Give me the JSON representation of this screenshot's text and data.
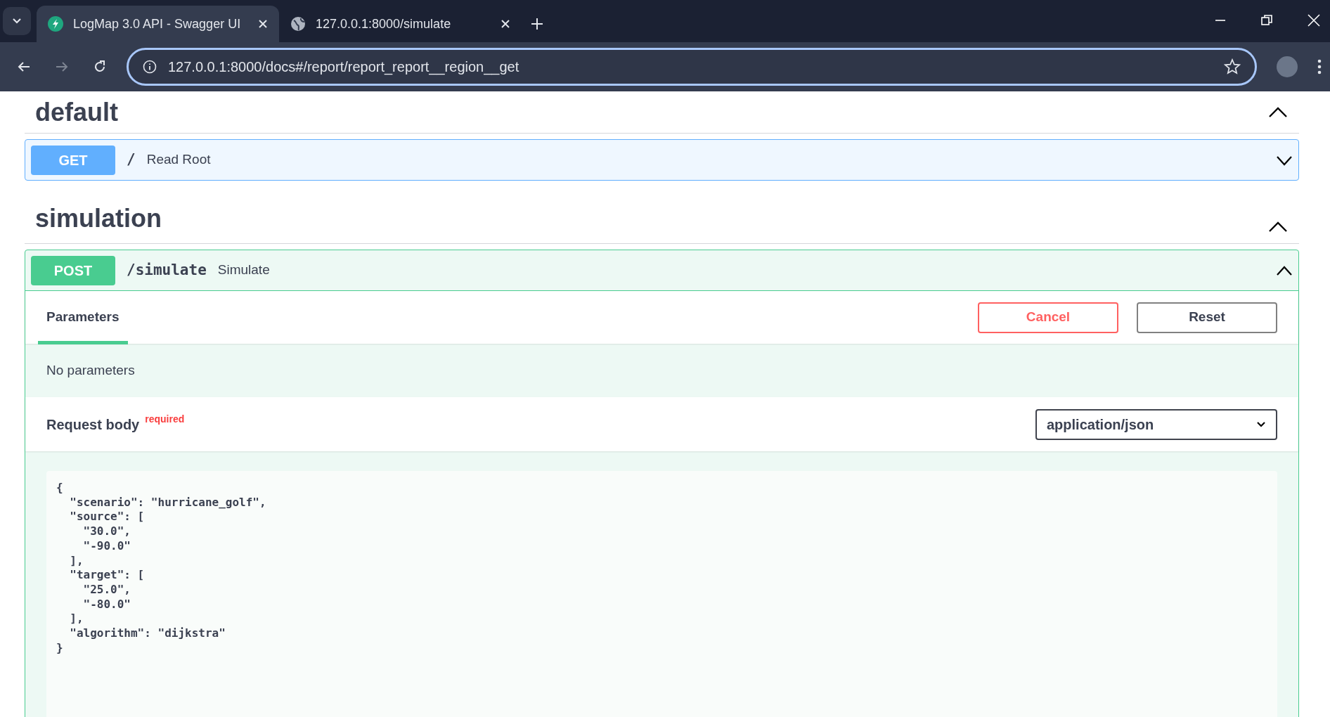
{
  "browser": {
    "tabs": [
      {
        "title": "LogMap 3.0 API - Swagger UI",
        "selected": true,
        "kind": "app"
      },
      {
        "title": "127.0.0.1:8000/simulate",
        "selected": false,
        "kind": "globe"
      }
    ],
    "address": "127.0.0.1:8000/docs#/report/report_report__region__get"
  },
  "sections": [
    {
      "name": "default",
      "expanded": true,
      "operations": [
        {
          "method": "GET",
          "path": "/",
          "summary": "Read Root",
          "expanded": false
        }
      ]
    },
    {
      "name": "simulation",
      "expanded": true,
      "operations": [
        {
          "method": "POST",
          "path": "/simulate",
          "summary": "Simulate",
          "expanded": true,
          "tabs": [
            {
              "label": "Parameters",
              "selected": true
            }
          ],
          "buttons": [
            {
              "label": "Cancel",
              "kind": "cancel"
            },
            {
              "label": "Reset",
              "kind": "reset"
            }
          ],
          "parameters_note": "No parameters",
          "request_body": {
            "label": "Request body",
            "required_label": "required",
            "content_type": "application/json",
            "body_lines": [
              "{",
              "  \"scenario\": \"hurricane_golf\",",
              "  \"source\": [",
              "    \"30.0\",",
              "    \"-90.0\"",
              "  ],",
              "  \"target\": [",
              "    \"25.0\",",
              "    \"-80.0\"",
              "  ],",
              "  \"algorithm\": \"dijkstra\"",
              "}"
            ]
          }
        }
      ]
    }
  ]
}
